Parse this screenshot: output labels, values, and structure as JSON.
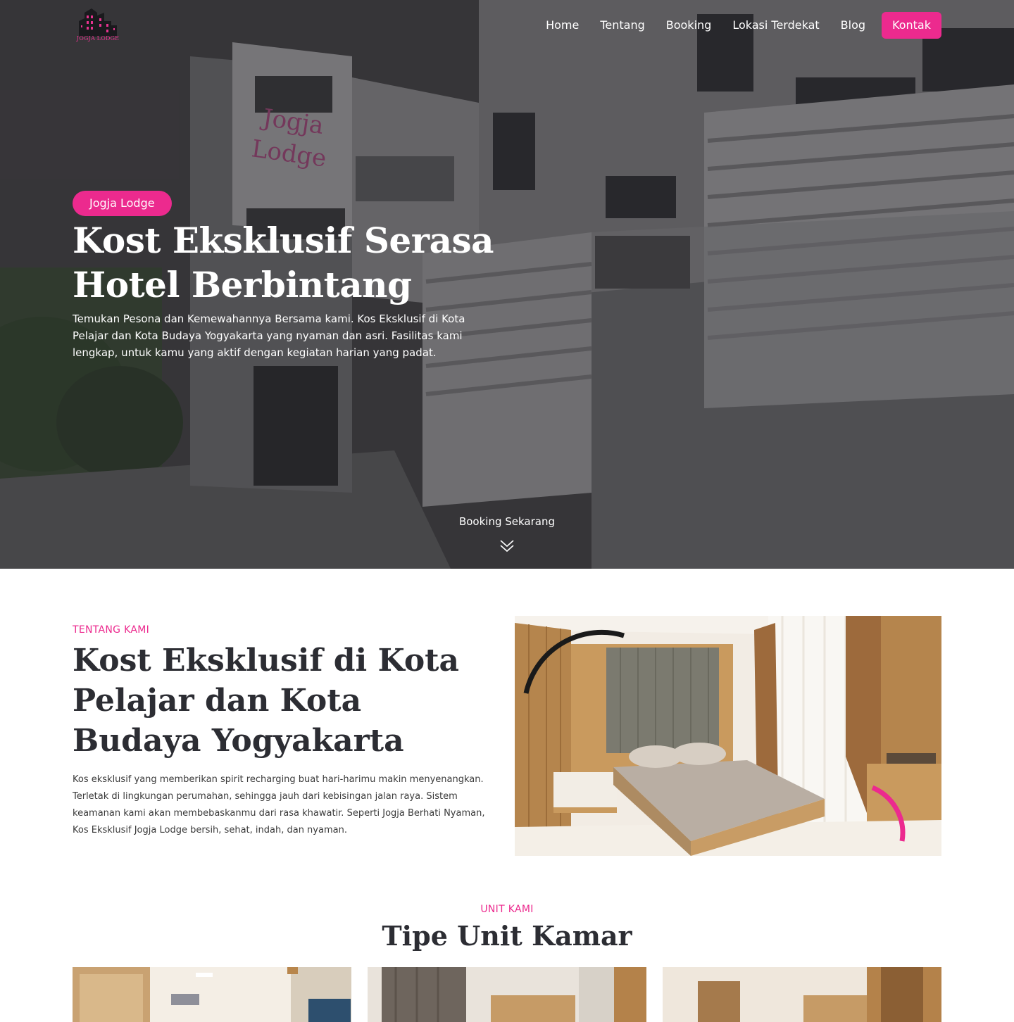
{
  "brand": {
    "name": "JOGJA LODGE",
    "accent": "#ec2a8e"
  },
  "nav": {
    "items": [
      "Home",
      "Tentang",
      "Booking",
      "Lokasi Terdekat",
      "Blog"
    ],
    "cta": "Kontak"
  },
  "hero": {
    "badge": "Jogja Lodge",
    "title": "Kost Eksklusif Serasa Hotel Berbintang",
    "description": "Temukan Pesona dan Kemewahannya Bersama kami. Kos Eksklusif di Kota Pelajar dan Kota Budaya Yogyakarta yang nyaman dan asri. Fasilitas kami lengkap, untuk kamu yang aktif dengan kegiatan harian yang padat.",
    "building_sign": "Jogja Lodge",
    "cta_label": "Booking Sekarang",
    "cta_icon": "double-chevron-down-icon"
  },
  "about": {
    "label": "TENTANG KAMI",
    "title": "Kost Eksklusif di Kota Pelajar dan Kota Budaya Yogyakarta",
    "description": "Kos eksklusif yang memberikan spirit recharging buat hari-harimu makin menyenangkan. Terletak di lingkungan perumahan, sehingga jauh dari kebisingan jalan raya. Sistem keamanan kami akan membebaskanmu dari rasa khawatir. Seperti Jogja Berhati Nyaman, Kos Eksklusif Jogja Lodge bersih, sehat, indah, dan nyaman."
  },
  "units": {
    "label": "UNIT KAMI",
    "title": "Tipe Unit Kamar"
  }
}
